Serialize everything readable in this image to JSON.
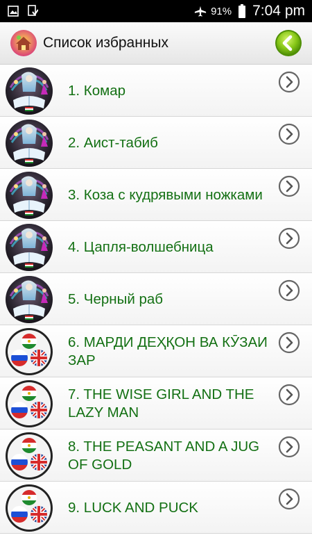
{
  "status_bar": {
    "battery": "91%",
    "time": "7:04 pm",
    "icons": [
      "gallery-icon",
      "download-done-icon",
      "airplane-icon",
      "battery-icon"
    ]
  },
  "app_bar": {
    "title": "Список избранных",
    "logo": "house-logo-icon",
    "back": "back-arrow-icon"
  },
  "colors": {
    "item_text": "#137013",
    "back_button": "#7dc20f"
  },
  "items": [
    {
      "label": "1. Комар",
      "thumb": "fairytale-book-icon"
    },
    {
      "label": "2. Аист-табиб",
      "thumb": "fairytale-book-icon"
    },
    {
      "label": "3. Коза с кудрявыми ножками",
      "thumb": "fairytale-book-icon"
    },
    {
      "label": "4. Цапля-волшебница",
      "thumb": "fairytale-book-icon"
    },
    {
      "label": "5. Черный раб",
      "thumb": "fairytale-book-icon"
    },
    {
      "label": "6. МАРДИ ДЕҲҚОН ВА КӮЗАИ ЗАР",
      "thumb": "flags-icon"
    },
    {
      "label": "7. THE WISE GIRL AND THE LAZY MAN",
      "thumb": "flags-icon"
    },
    {
      "label": "8. THE PEASANT AND A JUG OF GOLD",
      "thumb": "flags-icon"
    },
    {
      "label": "9. LUCK AND PUCK",
      "thumb": "flags-icon"
    }
  ]
}
